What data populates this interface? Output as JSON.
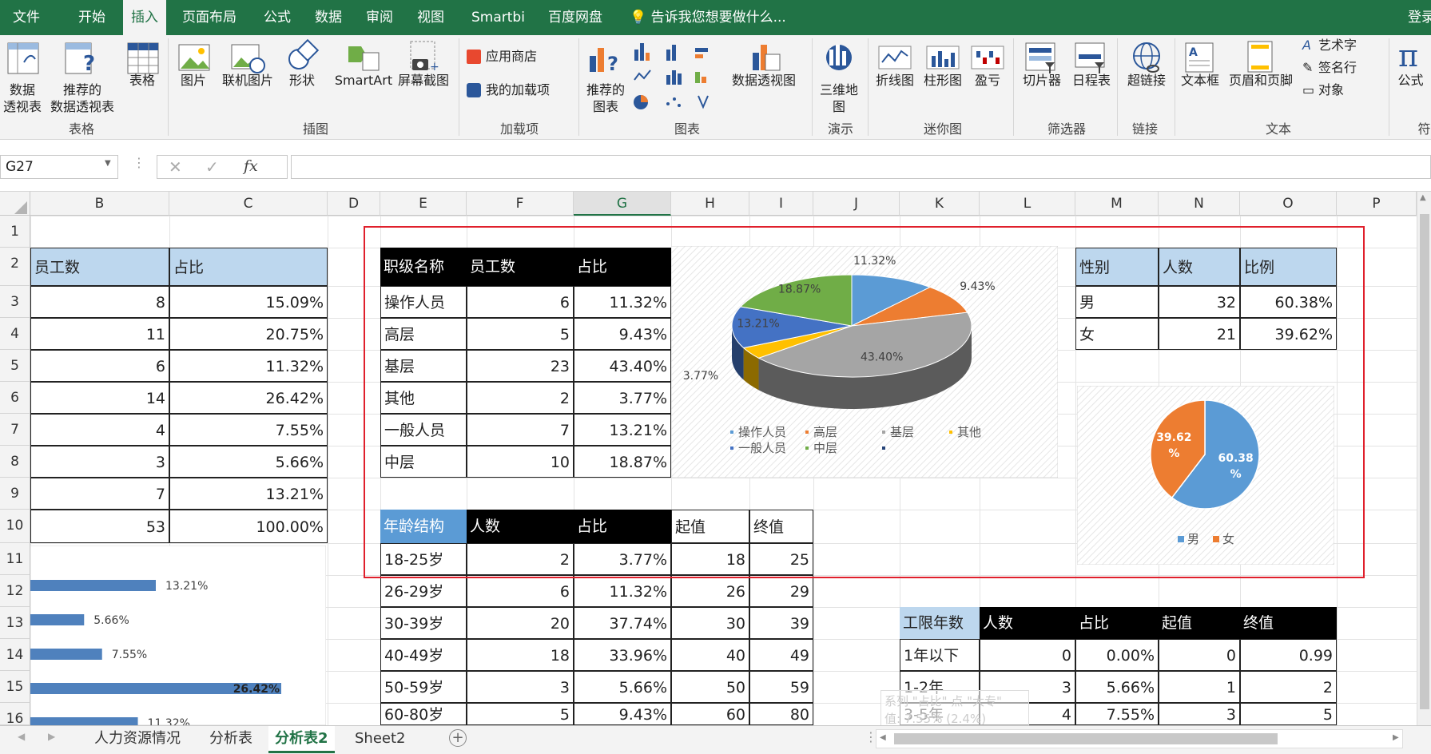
{
  "ribbon_tabs": [
    "文件",
    "开始",
    "插入",
    "页面布局",
    "公式",
    "数据",
    "审阅",
    "视图",
    "Smartbi",
    "百度网盘"
  ],
  "tell_me": "告诉我您想要做什么...",
  "login": "登录",
  "ribbon": {
    "pivot": [
      "数据",
      "透视表"
    ],
    "rec_pivot": [
      "推荐的",
      "数据透视表"
    ],
    "table": "表格",
    "group_table": "表格",
    "picture": "图片",
    "online_picture": "联机图片",
    "shapes": "形状",
    "smartart": "SmartArt",
    "screenshot": "屏幕截图",
    "group_illus": "插图",
    "store": "应用商店",
    "my_addins": "我的加载项",
    "group_addins": "加载项",
    "rec_charts": [
      "推荐的",
      "图表"
    ],
    "pivot_chart": "数据透视图",
    "group_charts": "图表",
    "map3d": [
      "三维地",
      "图"
    ],
    "group_tour": "演示",
    "spark_line": "折线图",
    "spark_col": "柱形图",
    "spark_wl": "盈亏",
    "group_spark": "迷你图",
    "slicer": "切片器",
    "timeline": "日程表",
    "group_filter": "筛选器",
    "hyperlink": "超链接",
    "group_links": "链接",
    "textbox": "文本框",
    "header_footer": "页眉和页脚",
    "wordart": "艺术字",
    "signature": "签名行",
    "object": "对象",
    "group_text": "文本",
    "equation": "公式",
    "group_sym": "符"
  },
  "name_box": "G27",
  "fx": "fx",
  "columns": [
    "B",
    "C",
    "D",
    "E",
    "F",
    "G",
    "H",
    "I",
    "J",
    "K",
    "L",
    "M",
    "N",
    "O",
    "P"
  ],
  "rows": [
    "1",
    "2",
    "3",
    "4",
    "5",
    "6",
    "7",
    "8",
    "9",
    "10",
    "11",
    "12",
    "13",
    "14",
    "15",
    "16"
  ],
  "left_table": {
    "headers": [
      "员工数",
      "占比"
    ],
    "rows": [
      [
        "8",
        "15.09%"
      ],
      [
        "11",
        "20.75%"
      ],
      [
        "6",
        "11.32%"
      ],
      [
        "14",
        "26.42%"
      ],
      [
        "4",
        "7.55%"
      ],
      [
        "3",
        "5.66%"
      ],
      [
        "7",
        "13.21%"
      ],
      [
        "53",
        "100.00%"
      ]
    ]
  },
  "level_table": {
    "headers": [
      "职级名称",
      "员工数",
      "占比"
    ],
    "rows": [
      [
        "操作人员",
        "6",
        "11.32%"
      ],
      [
        "高层",
        "5",
        "9.43%"
      ],
      [
        "基层",
        "23",
        "43.40%"
      ],
      [
        "其他",
        "2",
        "3.77%"
      ],
      [
        "一般人员",
        "7",
        "13.21%"
      ],
      [
        "中层",
        "10",
        "18.87%"
      ]
    ]
  },
  "gender_table": {
    "headers": [
      "性别",
      "人数",
      "比例"
    ],
    "rows": [
      [
        "男",
        "32",
        "60.38%"
      ],
      [
        "女",
        "21",
        "39.62%"
      ]
    ]
  },
  "age_table": {
    "headers": [
      "年龄结构",
      "人数",
      "占比",
      "起值",
      "终值"
    ],
    "rows": [
      [
        "18-25岁",
        "2",
        "3.77%",
        "18",
        "25"
      ],
      [
        "26-29岁",
        "6",
        "11.32%",
        "26",
        "29"
      ],
      [
        "30-39岁",
        "20",
        "37.74%",
        "30",
        "39"
      ],
      [
        "40-49岁",
        "18",
        "33.96%",
        "40",
        "49"
      ],
      [
        "50-59岁",
        "3",
        "5.66%",
        "50",
        "59"
      ],
      [
        "60-80岁",
        "5",
        "9.43%",
        "60",
        "80"
      ]
    ]
  },
  "tenure_table": {
    "headers": [
      "工限年数",
      "人数",
      "占比",
      "起值",
      "终值"
    ],
    "rows": [
      [
        "1年以下",
        "0",
        "0.00%",
        "0",
        "0.99"
      ],
      [
        "1-2年",
        "3",
        "5.66%",
        "1",
        "2"
      ],
      [
        "3-5年",
        "4",
        "7.55%",
        "3",
        "5"
      ]
    ]
  },
  "tooltip": [
    "系列 \"占比\" 点 \"大专\"",
    "值: 7.55% (2.4%)"
  ],
  "sheet_tabs": [
    "人力资源情况",
    "分析表",
    "分析表2",
    "Sheet2"
  ],
  "active_sheet": "分析表2",
  "chart_data": [
    {
      "type": "pie",
      "categories": [
        "操作人员",
        "高层",
        "基层",
        "其他",
        "一般人员",
        "中层"
      ],
      "values": [
        11.32,
        9.43,
        43.4,
        3.77,
        13.21,
        18.87
      ],
      "labels": [
        "11.32%",
        "9.43%",
        "43.40%",
        "3.77%",
        "13.21%",
        "18.87%"
      ],
      "colors": [
        "#5b9bd5",
        "#ed7d31",
        "#a5a5a5",
        "#ffc000",
        "#4472c4",
        "#70ad47"
      ],
      "legend": "bottom",
      "style": "3d"
    },
    {
      "type": "pie",
      "categories": [
        "男",
        "女"
      ],
      "values": [
        60.38,
        39.62
      ],
      "labels": [
        "60.38%",
        "39.62%"
      ],
      "colors": [
        "#5b9bd5",
        "#ed7d31"
      ],
      "legend": "bottom"
    },
    {
      "type": "bar",
      "values": [
        13.21,
        5.66,
        7.55,
        26.42,
        11.32
      ],
      "labels": [
        "13.21%",
        "5.66%",
        "7.55%",
        "26.42%",
        "11.32%"
      ],
      "color": "#4f81bd",
      "xlim": [
        0,
        26.42
      ]
    }
  ]
}
